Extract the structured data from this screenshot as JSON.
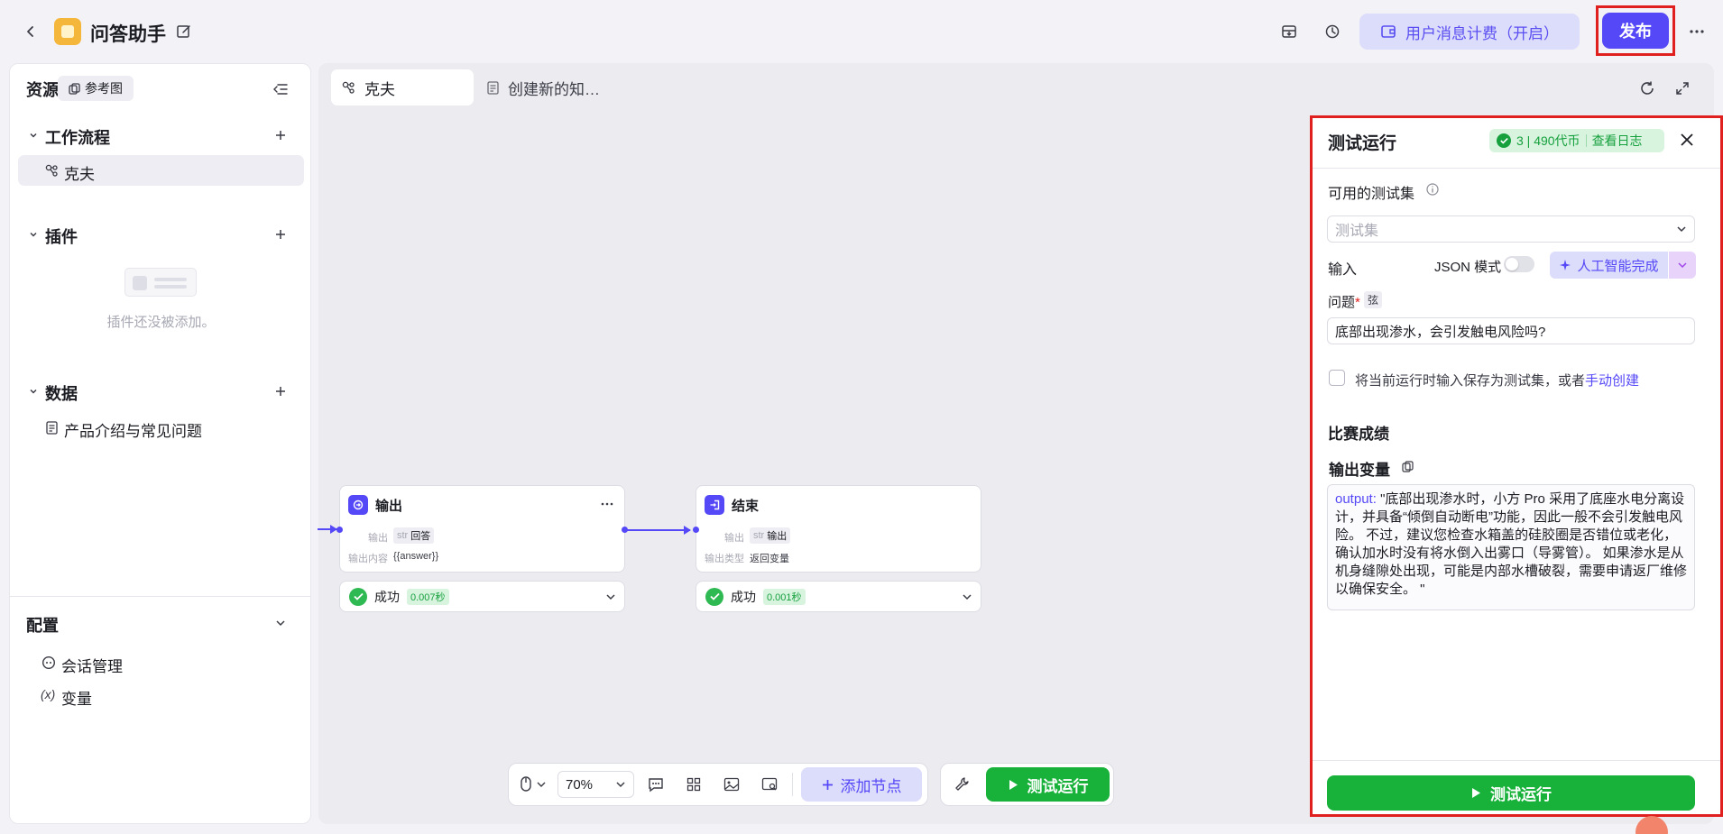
{
  "header": {
    "app_title": "问答助手",
    "billing_label": "用户消息计费（开启）",
    "publish_label": "发布"
  },
  "sidebar": {
    "resources_title": "资源",
    "reference_chip": "参考图",
    "sections": {
      "workflow": "工作流程",
      "plugins": "插件",
      "data": "数据",
      "config": "配置"
    },
    "workflow_item": "克夫",
    "plugins_empty": "插件还没被添加。",
    "data_item": "产品介绍与常见问题",
    "config_items": [
      "会话管理",
      "变量"
    ]
  },
  "tabs": [
    {
      "label": "克夫"
    },
    {
      "label": "创建新的知…"
    }
  ],
  "nodes": {
    "output": {
      "title": "输出",
      "row1_label": "输出",
      "row1_type": "str",
      "row1_value": "回答",
      "row2_label": "输出内容",
      "row2_value": "{{answer}}",
      "status": "成功",
      "time": "0.007秒"
    },
    "end": {
      "title": "结束",
      "row1_label": "输出",
      "row1_type": "str",
      "row1_value": "输出",
      "row2_label": "输出类型",
      "row2_value": "返回变量",
      "status": "成功",
      "time": "0.001秒"
    }
  },
  "toolbar": {
    "zoom": "70%",
    "add_node_label": "添加节点",
    "run_label": "测试运行"
  },
  "panel": {
    "title": "测试运行",
    "cost": "3 | 490代币",
    "view_log": "查看日志",
    "testset_label": "可用的测试集",
    "testset_placeholder": "测试集",
    "input_label": "输入",
    "json_mode_label": "JSON 模式",
    "ai_complete_label": "人工智能完成",
    "question_label": "问题",
    "required_mark": "*",
    "question_type": "弦",
    "question_value": "底部出现渗水，会引发触电风险吗?",
    "save_text": "将当前运行时输入保存为测试集，或者",
    "manual_create": "手动创建",
    "results_title": "比赛成绩",
    "output_var_label": "输出变量",
    "output_key": "output",
    "output_value": "\"底部出现渗水时，小方 Pro 采用了底座水电分离设计，并具备“倾倒自动断电”功能，因此一般不会引发触电风险。 不过，建议您检查水箱盖的硅胶圈是否错位或老化，确认加水时没有将水倒入出雾口（导雾管）。 如果渗水是从机身缝隙处出现，可能是内部水槽破裂，需要申请返厂维修以确保安全。 \"",
    "run_label": "测试运行"
  },
  "colors": {
    "accent": "#5548f6",
    "success": "#18b23b",
    "highlight_frame": "#e0201e"
  }
}
